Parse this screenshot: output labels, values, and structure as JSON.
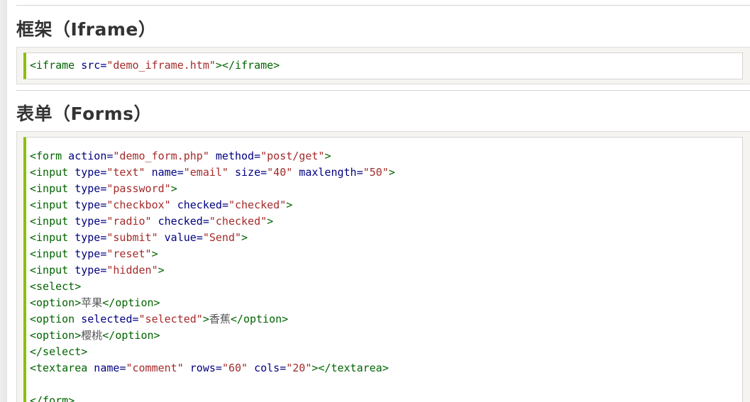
{
  "sections": [
    {
      "title": "框架（Iframe）",
      "code_lines": [
        [
          {
            "t": "tag",
            "s": "<iframe"
          },
          {
            "t": "attr",
            "s": " src"
          },
          {
            "t": "eq",
            "s": "="
          },
          {
            "t": "val",
            "s": "\"demo_iframe.htm\""
          },
          {
            "t": "tag",
            "s": "></iframe>"
          }
        ]
      ]
    },
    {
      "title": "表单（Forms）",
      "code_lines": [
        [
          {
            "t": "tag",
            "s": "<form"
          },
          {
            "t": "attr",
            "s": " action"
          },
          {
            "t": "eq",
            "s": "="
          },
          {
            "t": "val",
            "s": "\"demo_form.php\""
          },
          {
            "t": "attr",
            "s": " method"
          },
          {
            "t": "eq",
            "s": "="
          },
          {
            "t": "val",
            "s": "\"post/get\""
          },
          {
            "t": "tag",
            "s": ">"
          }
        ],
        [
          {
            "t": "tag",
            "s": "<input"
          },
          {
            "t": "attr",
            "s": " type"
          },
          {
            "t": "eq",
            "s": "="
          },
          {
            "t": "val",
            "s": "\"text\""
          },
          {
            "t": "attr",
            "s": " name"
          },
          {
            "t": "eq",
            "s": "="
          },
          {
            "t": "val",
            "s": "\"email\""
          },
          {
            "t": "attr",
            "s": " size"
          },
          {
            "t": "eq",
            "s": "="
          },
          {
            "t": "val",
            "s": "\"40\""
          },
          {
            "t": "attr",
            "s": " maxlength"
          },
          {
            "t": "eq",
            "s": "="
          },
          {
            "t": "val",
            "s": "\"50\""
          },
          {
            "t": "tag",
            "s": ">"
          }
        ],
        [
          {
            "t": "tag",
            "s": "<input"
          },
          {
            "t": "attr",
            "s": " type"
          },
          {
            "t": "eq",
            "s": "="
          },
          {
            "t": "val",
            "s": "\"password\""
          },
          {
            "t": "tag",
            "s": ">"
          }
        ],
        [
          {
            "t": "tag",
            "s": "<input"
          },
          {
            "t": "attr",
            "s": " type"
          },
          {
            "t": "eq",
            "s": "="
          },
          {
            "t": "val",
            "s": "\"checkbox\""
          },
          {
            "t": "attr",
            "s": " checked"
          },
          {
            "t": "eq",
            "s": "="
          },
          {
            "t": "val",
            "s": "\"checked\""
          },
          {
            "t": "tag",
            "s": ">"
          }
        ],
        [
          {
            "t": "tag",
            "s": "<input"
          },
          {
            "t": "attr",
            "s": " type"
          },
          {
            "t": "eq",
            "s": "="
          },
          {
            "t": "val",
            "s": "\"radio\""
          },
          {
            "t": "attr",
            "s": " checked"
          },
          {
            "t": "eq",
            "s": "="
          },
          {
            "t": "val",
            "s": "\"checked\""
          },
          {
            "t": "tag",
            "s": ">"
          }
        ],
        [
          {
            "t": "tag",
            "s": "<input"
          },
          {
            "t": "attr",
            "s": " type"
          },
          {
            "t": "eq",
            "s": "="
          },
          {
            "t": "val",
            "s": "\"submit\""
          },
          {
            "t": "attr",
            "s": " value"
          },
          {
            "t": "eq",
            "s": "="
          },
          {
            "t": "val",
            "s": "\"Send\""
          },
          {
            "t": "tag",
            "s": ">"
          }
        ],
        [
          {
            "t": "tag",
            "s": "<input"
          },
          {
            "t": "attr",
            "s": " type"
          },
          {
            "t": "eq",
            "s": "="
          },
          {
            "t": "val",
            "s": "\"reset\""
          },
          {
            "t": "tag",
            "s": ">"
          }
        ],
        [
          {
            "t": "tag",
            "s": "<input"
          },
          {
            "t": "attr",
            "s": " type"
          },
          {
            "t": "eq",
            "s": "="
          },
          {
            "t": "val",
            "s": "\"hidden\""
          },
          {
            "t": "tag",
            "s": ">"
          }
        ],
        [
          {
            "t": "tag",
            "s": "<select>"
          }
        ],
        [
          {
            "t": "tag",
            "s": "<option>"
          },
          {
            "t": "txt",
            "s": "苹果"
          },
          {
            "t": "tag",
            "s": "</option>"
          }
        ],
        [
          {
            "t": "tag",
            "s": "<option"
          },
          {
            "t": "attr",
            "s": " selected"
          },
          {
            "t": "eq",
            "s": "="
          },
          {
            "t": "val",
            "s": "\"selected\""
          },
          {
            "t": "tag",
            "s": ">"
          },
          {
            "t": "txt",
            "s": "香蕉"
          },
          {
            "t": "tag",
            "s": "</option>"
          }
        ],
        [
          {
            "t": "tag",
            "s": "<option>"
          },
          {
            "t": "txt",
            "s": "樱桃"
          },
          {
            "t": "tag",
            "s": "</option>"
          }
        ],
        [
          {
            "t": "tag",
            "s": "</select>"
          }
        ],
        [
          {
            "t": "tag",
            "s": "<textarea"
          },
          {
            "t": "attr",
            "s": " name"
          },
          {
            "t": "eq",
            "s": "="
          },
          {
            "t": "val",
            "s": "\"comment\""
          },
          {
            "t": "attr",
            "s": " rows"
          },
          {
            "t": "eq",
            "s": "="
          },
          {
            "t": "val",
            "s": "\"60\""
          },
          {
            "t": "attr",
            "s": " cols"
          },
          {
            "t": "eq",
            "s": "="
          },
          {
            "t": "val",
            "s": "\"20\""
          },
          {
            "t": "tag",
            "s": "></textarea>"
          }
        ],
        [],
        [
          {
            "t": "tag",
            "s": "</form>"
          }
        ]
      ]
    }
  ],
  "colors": {
    "tag": "#006400",
    "attribute": "#000080",
    "value": "#a52a2a",
    "accent_border": "#8ac007",
    "example_background": "#f6f4f0"
  }
}
